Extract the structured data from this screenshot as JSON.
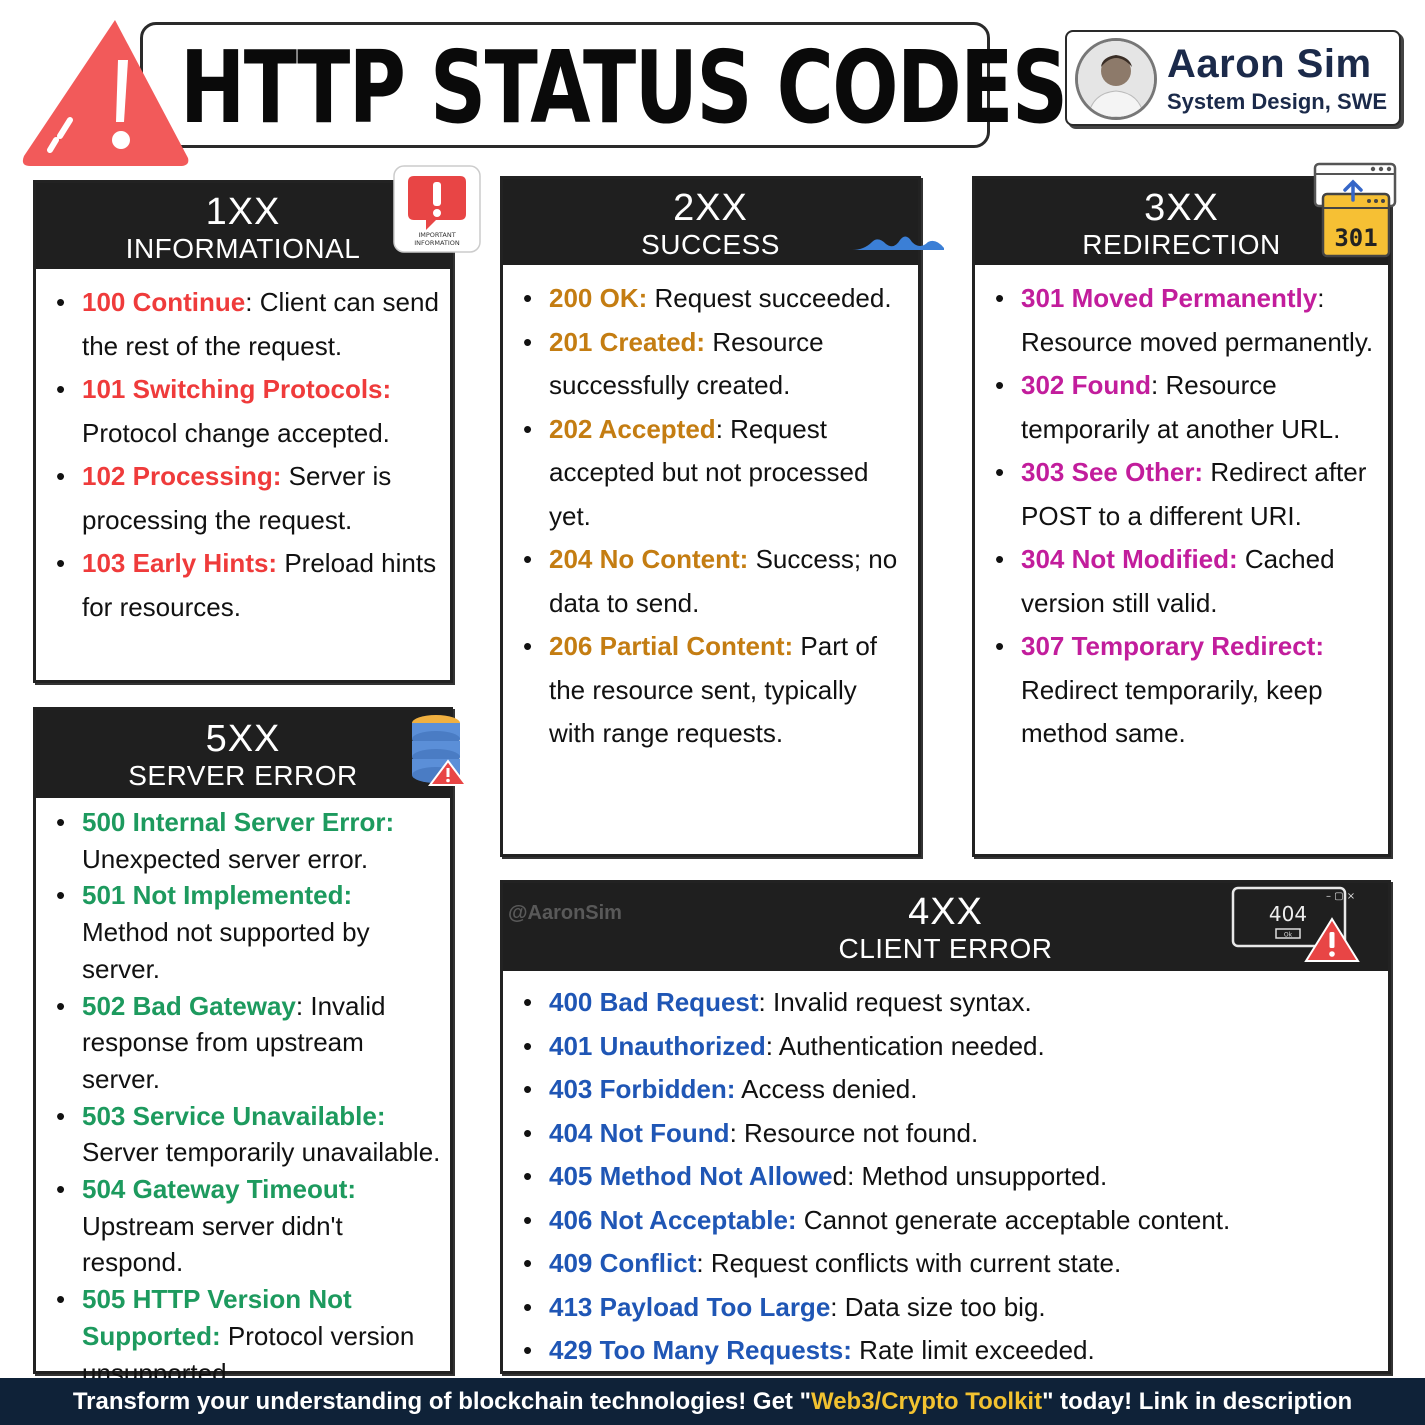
{
  "title": "HTTP STATUS CODES",
  "author": {
    "name": "Aaron Sim",
    "role": "System Design, SWE"
  },
  "watermark": "@AaronSim",
  "cards": {
    "informational": {
      "code": "1XX",
      "label": "INFORMATIONAL",
      "icon_text": "IMPORTANT INFORMATION",
      "items": [
        {
          "code": "100 Continue",
          "sep": ": ",
          "desc": "Client can send the rest of the request."
        },
        {
          "code": "101 Switching Protocols:",
          "sep": " ",
          "desc": "Protocol change accepted."
        },
        {
          "code": "102 Processing:",
          "sep": " ",
          "desc": "Server is processing the request."
        },
        {
          "code": "103 Early Hints:",
          "sep": " ",
          "desc": "Preload hints for resources."
        }
      ]
    },
    "success": {
      "code": "2XX",
      "label": "SUCCESS",
      "items": [
        {
          "code": "200 OK:",
          "sep": " ",
          "desc": "Request succeeded."
        },
        {
          "code": "201 Created:",
          "sep": " ",
          "desc": "Resource successfully created."
        },
        {
          "code": "202 Accepted",
          "sep": ": ",
          "desc": "Request accepted but not processed yet."
        },
        {
          "code": "204 No Content:",
          "sep": " ",
          "desc": "Success; no data to send."
        },
        {
          "code": "206 Partial Content:",
          "sep": " ",
          "desc": "Part of the resource sent, typically with range requests."
        }
      ]
    },
    "redirection": {
      "code": "3XX",
      "label": "REDIRECTION",
      "icon_text": "301",
      "items": [
        {
          "code": "301 Moved Permanently",
          "sep": ": ",
          "desc": "Resource moved permanently."
        },
        {
          "code": "302 Found",
          "sep": ": ",
          "desc": "Resource temporarily at another URL."
        },
        {
          "code": "303 See Other:",
          "sep": " ",
          "desc": "Redirect after POST to a different URI."
        },
        {
          "code": "304 Not Modified:",
          "sep": " ",
          "desc": "Cached version still valid."
        },
        {
          "code": "307 Temporary Redirect:",
          "sep": " ",
          "desc": "Redirect temporarily, keep method same."
        }
      ]
    },
    "client_error": {
      "code": "4XX",
      "label": "CLIENT ERROR",
      "icon_text": "404",
      "icon_button": "Ok",
      "items": [
        {
          "code": "400 Bad Request",
          "sep": ": ",
          "desc": "Invalid request syntax."
        },
        {
          "code": "401 Unauthorized",
          "sep": ": ",
          "desc": "Authentication needed."
        },
        {
          "code": "403 Forbidden:",
          "sep": " ",
          "desc": "Access denied."
        },
        {
          "code": "404 Not Found",
          "sep": ": ",
          "desc": "Resource not found."
        },
        {
          "code": "405 Method Not Allowe",
          "sep": "d: ",
          "desc": "Method unsupported."
        },
        {
          "code": "406 Not Acceptable:",
          "sep": " ",
          "desc": "Cannot generate acceptable content."
        },
        {
          "code": "409 Conflict",
          "sep": ": ",
          "desc": "Request conflicts with current state."
        },
        {
          "code": "413 Payload Too Large",
          "sep": ": ",
          "desc": "Data size too big."
        },
        {
          "code": "429 Too Many Requests:",
          "sep": " ",
          "desc": "Rate limit exceeded."
        }
      ]
    },
    "server_error": {
      "code": "5XX",
      "label": "SERVER ERROR",
      "items": [
        {
          "code": "500 Internal Server Error:",
          "sep": " ",
          "desc": "Unexpected server error."
        },
        {
          "code": "501 Not Implemented:",
          "sep": " ",
          "desc": "Method not supported by server."
        },
        {
          "code": "502 Bad Gateway",
          "sep": ": ",
          "desc": "Invalid response from upstream server."
        },
        {
          "code": "503 Service Unavailable:",
          "sep": " ",
          "desc": "Server temporarily unavailable."
        },
        {
          "code": "504 Gateway Timeout:",
          "sep": " ",
          "desc": "Upstream server didn't respond."
        },
        {
          "code": "505 HTTP Version Not Supported:",
          "sep": " ",
          "desc": "Protocol version unsupported."
        }
      ]
    }
  },
  "footer": {
    "before": "Transform your understanding of blockchain technologies! Get \"",
    "highlight": "Web3/Crypto Toolkit",
    "after": "\" today! Link in description"
  },
  "colors": {
    "informational": "#ef3b3b",
    "success": "#c47d12",
    "redirection": "#c21d9c",
    "client_error": "#1f56b5",
    "server_error": "#1d9a5e",
    "header_bg": "#1f1f1f",
    "footer_bg": "#0f2238",
    "footer_highlight": "#f2c230"
  }
}
